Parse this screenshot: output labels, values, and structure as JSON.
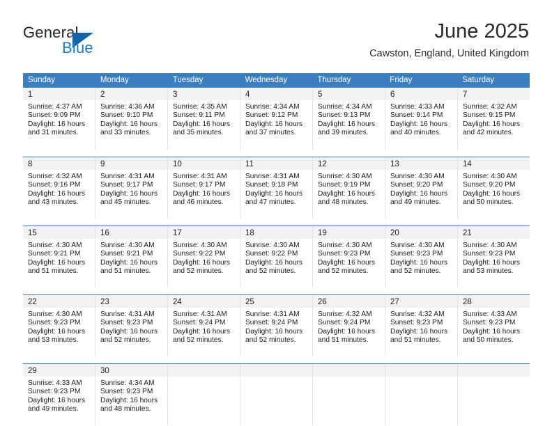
{
  "logo": {
    "word_top": "General",
    "word_bottom": "Blue",
    "accent_color": "#1263a8",
    "text_color": "#231f20"
  },
  "header": {
    "month_title": "June 2025",
    "location": "Cawston, England, United Kingdom"
  },
  "theme": {
    "header_blue": "#3c7fc1",
    "band_gray": "#f2f2f2",
    "grid_line": "#e2e2e2"
  },
  "calendar": {
    "weekdays": [
      "Sunday",
      "Monday",
      "Tuesday",
      "Wednesday",
      "Thursday",
      "Friday",
      "Saturday"
    ],
    "weeks": [
      [
        {
          "day": "1",
          "sunrise": "Sunrise: 4:37 AM",
          "sunset": "Sunset: 9:09 PM",
          "daylight_1": "Daylight: 16 hours",
          "daylight_2": "and 31 minutes."
        },
        {
          "day": "2",
          "sunrise": "Sunrise: 4:36 AM",
          "sunset": "Sunset: 9:10 PM",
          "daylight_1": "Daylight: 16 hours",
          "daylight_2": "and 33 minutes."
        },
        {
          "day": "3",
          "sunrise": "Sunrise: 4:35 AM",
          "sunset": "Sunset: 9:11 PM",
          "daylight_1": "Daylight: 16 hours",
          "daylight_2": "and 35 minutes."
        },
        {
          "day": "4",
          "sunrise": "Sunrise: 4:34 AM",
          "sunset": "Sunset: 9:12 PM",
          "daylight_1": "Daylight: 16 hours",
          "daylight_2": "and 37 minutes."
        },
        {
          "day": "5",
          "sunrise": "Sunrise: 4:34 AM",
          "sunset": "Sunset: 9:13 PM",
          "daylight_1": "Daylight: 16 hours",
          "daylight_2": "and 39 minutes."
        },
        {
          "day": "6",
          "sunrise": "Sunrise: 4:33 AM",
          "sunset": "Sunset: 9:14 PM",
          "daylight_1": "Daylight: 16 hours",
          "daylight_2": "and 40 minutes."
        },
        {
          "day": "7",
          "sunrise": "Sunrise: 4:32 AM",
          "sunset": "Sunset: 9:15 PM",
          "daylight_1": "Daylight: 16 hours",
          "daylight_2": "and 42 minutes."
        }
      ],
      [
        {
          "day": "8",
          "sunrise": "Sunrise: 4:32 AM",
          "sunset": "Sunset: 9:16 PM",
          "daylight_1": "Daylight: 16 hours",
          "daylight_2": "and 43 minutes."
        },
        {
          "day": "9",
          "sunrise": "Sunrise: 4:31 AM",
          "sunset": "Sunset: 9:17 PM",
          "daylight_1": "Daylight: 16 hours",
          "daylight_2": "and 45 minutes."
        },
        {
          "day": "10",
          "sunrise": "Sunrise: 4:31 AM",
          "sunset": "Sunset: 9:17 PM",
          "daylight_1": "Daylight: 16 hours",
          "daylight_2": "and 46 minutes."
        },
        {
          "day": "11",
          "sunrise": "Sunrise: 4:31 AM",
          "sunset": "Sunset: 9:18 PM",
          "daylight_1": "Daylight: 16 hours",
          "daylight_2": "and 47 minutes."
        },
        {
          "day": "12",
          "sunrise": "Sunrise: 4:30 AM",
          "sunset": "Sunset: 9:19 PM",
          "daylight_1": "Daylight: 16 hours",
          "daylight_2": "and 48 minutes."
        },
        {
          "day": "13",
          "sunrise": "Sunrise: 4:30 AM",
          "sunset": "Sunset: 9:20 PM",
          "daylight_1": "Daylight: 16 hours",
          "daylight_2": "and 49 minutes."
        },
        {
          "day": "14",
          "sunrise": "Sunrise: 4:30 AM",
          "sunset": "Sunset: 9:20 PM",
          "daylight_1": "Daylight: 16 hours",
          "daylight_2": "and 50 minutes."
        }
      ],
      [
        {
          "day": "15",
          "sunrise": "Sunrise: 4:30 AM",
          "sunset": "Sunset: 9:21 PM",
          "daylight_1": "Daylight: 16 hours",
          "daylight_2": "and 51 minutes."
        },
        {
          "day": "16",
          "sunrise": "Sunrise: 4:30 AM",
          "sunset": "Sunset: 9:21 PM",
          "daylight_1": "Daylight: 16 hours",
          "daylight_2": "and 51 minutes."
        },
        {
          "day": "17",
          "sunrise": "Sunrise: 4:30 AM",
          "sunset": "Sunset: 9:22 PM",
          "daylight_1": "Daylight: 16 hours",
          "daylight_2": "and 52 minutes."
        },
        {
          "day": "18",
          "sunrise": "Sunrise: 4:30 AM",
          "sunset": "Sunset: 9:22 PM",
          "daylight_1": "Daylight: 16 hours",
          "daylight_2": "and 52 minutes."
        },
        {
          "day": "19",
          "sunrise": "Sunrise: 4:30 AM",
          "sunset": "Sunset: 9:23 PM",
          "daylight_1": "Daylight: 16 hours",
          "daylight_2": "and 52 minutes."
        },
        {
          "day": "20",
          "sunrise": "Sunrise: 4:30 AM",
          "sunset": "Sunset: 9:23 PM",
          "daylight_1": "Daylight: 16 hours",
          "daylight_2": "and 52 minutes."
        },
        {
          "day": "21",
          "sunrise": "Sunrise: 4:30 AM",
          "sunset": "Sunset: 9:23 PM",
          "daylight_1": "Daylight: 16 hours",
          "daylight_2": "and 53 minutes."
        }
      ],
      [
        {
          "day": "22",
          "sunrise": "Sunrise: 4:30 AM",
          "sunset": "Sunset: 9:23 PM",
          "daylight_1": "Daylight: 16 hours",
          "daylight_2": "and 53 minutes."
        },
        {
          "day": "23",
          "sunrise": "Sunrise: 4:31 AM",
          "sunset": "Sunset: 9:23 PM",
          "daylight_1": "Daylight: 16 hours",
          "daylight_2": "and 52 minutes."
        },
        {
          "day": "24",
          "sunrise": "Sunrise: 4:31 AM",
          "sunset": "Sunset: 9:24 PM",
          "daylight_1": "Daylight: 16 hours",
          "daylight_2": "and 52 minutes."
        },
        {
          "day": "25",
          "sunrise": "Sunrise: 4:31 AM",
          "sunset": "Sunset: 9:24 PM",
          "daylight_1": "Daylight: 16 hours",
          "daylight_2": "and 52 minutes."
        },
        {
          "day": "26",
          "sunrise": "Sunrise: 4:32 AM",
          "sunset": "Sunset: 9:24 PM",
          "daylight_1": "Daylight: 16 hours",
          "daylight_2": "and 51 minutes."
        },
        {
          "day": "27",
          "sunrise": "Sunrise: 4:32 AM",
          "sunset": "Sunset: 9:23 PM",
          "daylight_1": "Daylight: 16 hours",
          "daylight_2": "and 51 minutes."
        },
        {
          "day": "28",
          "sunrise": "Sunrise: 4:33 AM",
          "sunset": "Sunset: 9:23 PM",
          "daylight_1": "Daylight: 16 hours",
          "daylight_2": "and 50 minutes."
        }
      ],
      [
        {
          "day": "29",
          "sunrise": "Sunrise: 4:33 AM",
          "sunset": "Sunset: 9:23 PM",
          "daylight_1": "Daylight: 16 hours",
          "daylight_2": "and 49 minutes."
        },
        {
          "day": "30",
          "sunrise": "Sunrise: 4:34 AM",
          "sunset": "Sunset: 9:23 PM",
          "daylight_1": "Daylight: 16 hours",
          "daylight_2": "and 48 minutes."
        },
        {
          "day": "",
          "sunrise": "",
          "sunset": "",
          "daylight_1": "",
          "daylight_2": ""
        },
        {
          "day": "",
          "sunrise": "",
          "sunset": "",
          "daylight_1": "",
          "daylight_2": ""
        },
        {
          "day": "",
          "sunrise": "",
          "sunset": "",
          "daylight_1": "",
          "daylight_2": ""
        },
        {
          "day": "",
          "sunrise": "",
          "sunset": "",
          "daylight_1": "",
          "daylight_2": ""
        },
        {
          "day": "",
          "sunrise": "",
          "sunset": "",
          "daylight_1": "",
          "daylight_2": ""
        }
      ]
    ]
  }
}
